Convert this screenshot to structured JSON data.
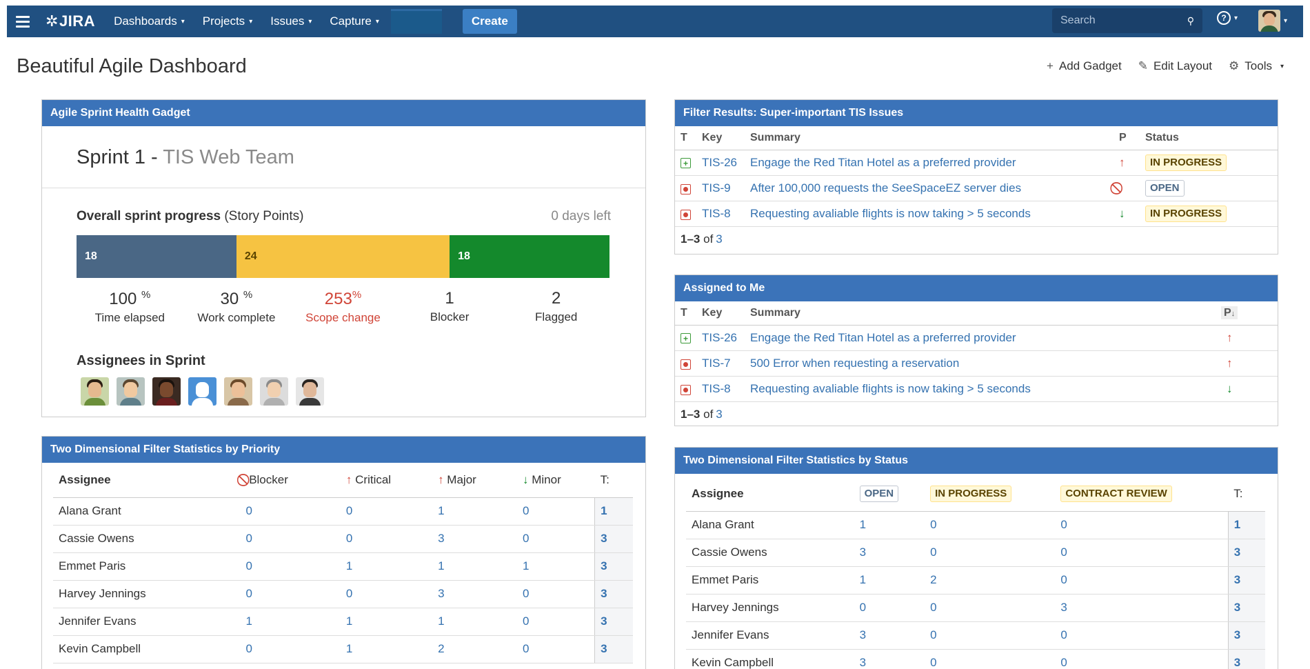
{
  "nav": {
    "logo_text": "JIRA",
    "menus": [
      "Dashboards",
      "Projects",
      "Issues",
      "Capture"
    ],
    "create_label": "Create",
    "search_placeholder": "Search",
    "brand_color": "#205081"
  },
  "page": {
    "title": "Beautiful Agile Dashboard",
    "actions": {
      "add_gadget": "Add Gadget",
      "edit_layout": "Edit Layout",
      "tools": "Tools"
    }
  },
  "sprint_health": {
    "header": "Agile Sprint Health Gadget",
    "sprint_name": "Sprint 1 - ",
    "team_name": "TIS Web Team",
    "progress_label_bold": "Overall sprint progress",
    "progress_label_rest": " (Story Points)",
    "days_left": "0 days left",
    "progress": [
      {
        "value": "18",
        "color": "#4a6785",
        "text_color": "#ffffff",
        "fraction": 0.3
      },
      {
        "value": "24",
        "color": "#f6c342",
        "text_color": "#594300",
        "fraction": 0.4
      },
      {
        "value": "18",
        "color": "#14892c",
        "text_color": "#ffffff",
        "fraction": 0.3
      }
    ],
    "stats": [
      {
        "num": "100",
        "sup": "%",
        "label": "Time elapsed"
      },
      {
        "num": "30",
        "sup": "%",
        "label": "Work complete"
      },
      {
        "num": "253",
        "sup": "%",
        "label": "Scope change"
      },
      {
        "num": "1",
        "sup": "",
        "label": "Blocker"
      },
      {
        "num": "2",
        "sup": "",
        "label": "Flagged"
      }
    ],
    "assignees_label": "Assignees in Sprint"
  },
  "filter_results": {
    "header": "Filter Results: Super-important TIS Issues",
    "columns": [
      "T",
      "Key",
      "Summary",
      "P",
      "Status"
    ],
    "rows": [
      {
        "type": "story",
        "key": "TIS-26",
        "summary": "Engage the Red Titan Hotel as a preferred provider",
        "priority": "major",
        "status": "IN PROGRESS"
      },
      {
        "type": "bug",
        "key": "TIS-9",
        "summary": "After 100,000 requests the SeeSpaceEZ server dies",
        "priority": "blocker",
        "status": "OPEN"
      },
      {
        "type": "bug",
        "key": "TIS-8",
        "summary": "Requesting avaliable flights is now taking > 5 seconds",
        "priority": "minor",
        "status": "IN PROGRESS"
      }
    ],
    "count_prefix": "1–3",
    "count_of": "of",
    "count_total": "3"
  },
  "assigned_to_me": {
    "header": "Assigned to Me",
    "columns": [
      "T",
      "Key",
      "Summary",
      "P"
    ],
    "rows": [
      {
        "type": "story",
        "key": "TIS-26",
        "summary": "Engage the Red Titan Hotel as a preferred provider",
        "priority": "major"
      },
      {
        "type": "bug",
        "key": "TIS-7",
        "summary": "500 Error when requesting a reservation",
        "priority": "major"
      },
      {
        "type": "bug",
        "key": "TIS-8",
        "summary": "Requesting avaliable flights is now taking > 5 seconds",
        "priority": "minor"
      }
    ],
    "count_prefix": "1–3",
    "count_of": "of",
    "count_total": "3"
  },
  "stats_priority": {
    "header": "Two Dimensional Filter Statistics by Priority",
    "columns": [
      "Assignee",
      "Blocker",
      "Critical",
      "Major",
      "Minor",
      "T:"
    ],
    "rows": [
      [
        "Alana Grant",
        "0",
        "0",
        "1",
        "0",
        "1"
      ],
      [
        "Cassie Owens",
        "0",
        "0",
        "3",
        "0",
        "3"
      ],
      [
        "Emmet Paris",
        "0",
        "1",
        "1",
        "1",
        "3"
      ],
      [
        "Harvey Jennings",
        "0",
        "0",
        "3",
        "0",
        "3"
      ],
      [
        "Jennifer Evans",
        "1",
        "1",
        "1",
        "0",
        "3"
      ],
      [
        "Kevin Campbell",
        "0",
        "1",
        "2",
        "0",
        "3"
      ]
    ]
  },
  "stats_status": {
    "header": "Two Dimensional Filter Statistics by Status",
    "columns": [
      "Assignee",
      "OPEN",
      "IN PROGRESS",
      "CONTRACT REVIEW",
      "T:"
    ],
    "rows": [
      [
        "Alana Grant",
        "1",
        "0",
        "0",
        "1"
      ],
      [
        "Cassie Owens",
        "3",
        "0",
        "0",
        "3"
      ],
      [
        "Emmet Paris",
        "1",
        "2",
        "0",
        "3"
      ],
      [
        "Harvey Jennings",
        "0",
        "0",
        "3",
        "3"
      ],
      [
        "Jennifer Evans",
        "3",
        "0",
        "0",
        "3"
      ],
      [
        "Kevin Campbell",
        "3",
        "0",
        "0",
        "3"
      ]
    ]
  }
}
